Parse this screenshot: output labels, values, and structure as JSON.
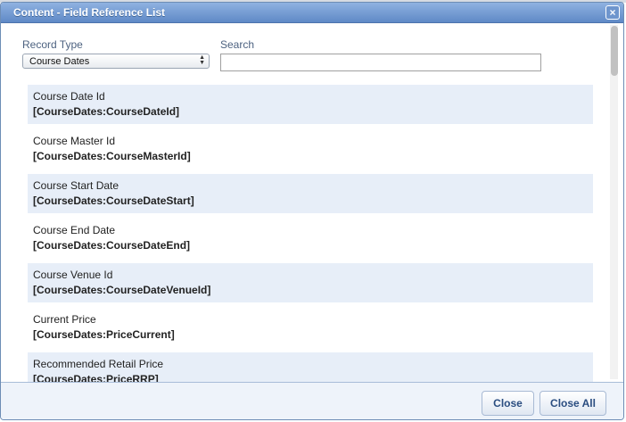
{
  "dialog": {
    "title": "Content - Field Reference List",
    "close_icon": "×"
  },
  "filters": {
    "record_type_label": "Record Type",
    "record_type_value": "Course Dates",
    "search_label": "Search",
    "search_value": ""
  },
  "fields": [
    {
      "name": "Course Date Id",
      "ref": "[CourseDates:CourseDateId]"
    },
    {
      "name": "Course Master Id",
      "ref": "[CourseDates:CourseMasterId]"
    },
    {
      "name": "Course Start Date",
      "ref": "[CourseDates:CourseDateStart]"
    },
    {
      "name": "Course End Date",
      "ref": "[CourseDates:CourseDateEnd]"
    },
    {
      "name": "Course Venue Id",
      "ref": "[CourseDates:CourseDateVenueId]"
    },
    {
      "name": "Current Price",
      "ref": "[CourseDates:PriceCurrent]"
    },
    {
      "name": "Recommended Retail Price",
      "ref": "[CourseDates:PriceRRP]"
    }
  ],
  "footer": {
    "close_label": "Close",
    "close_all_label": "Close All"
  },
  "colors": {
    "titlebar": "#6f97d0",
    "row_alt": "#e7eef8",
    "footer": "#eef3fa",
    "button_text": "#2a4d80"
  }
}
